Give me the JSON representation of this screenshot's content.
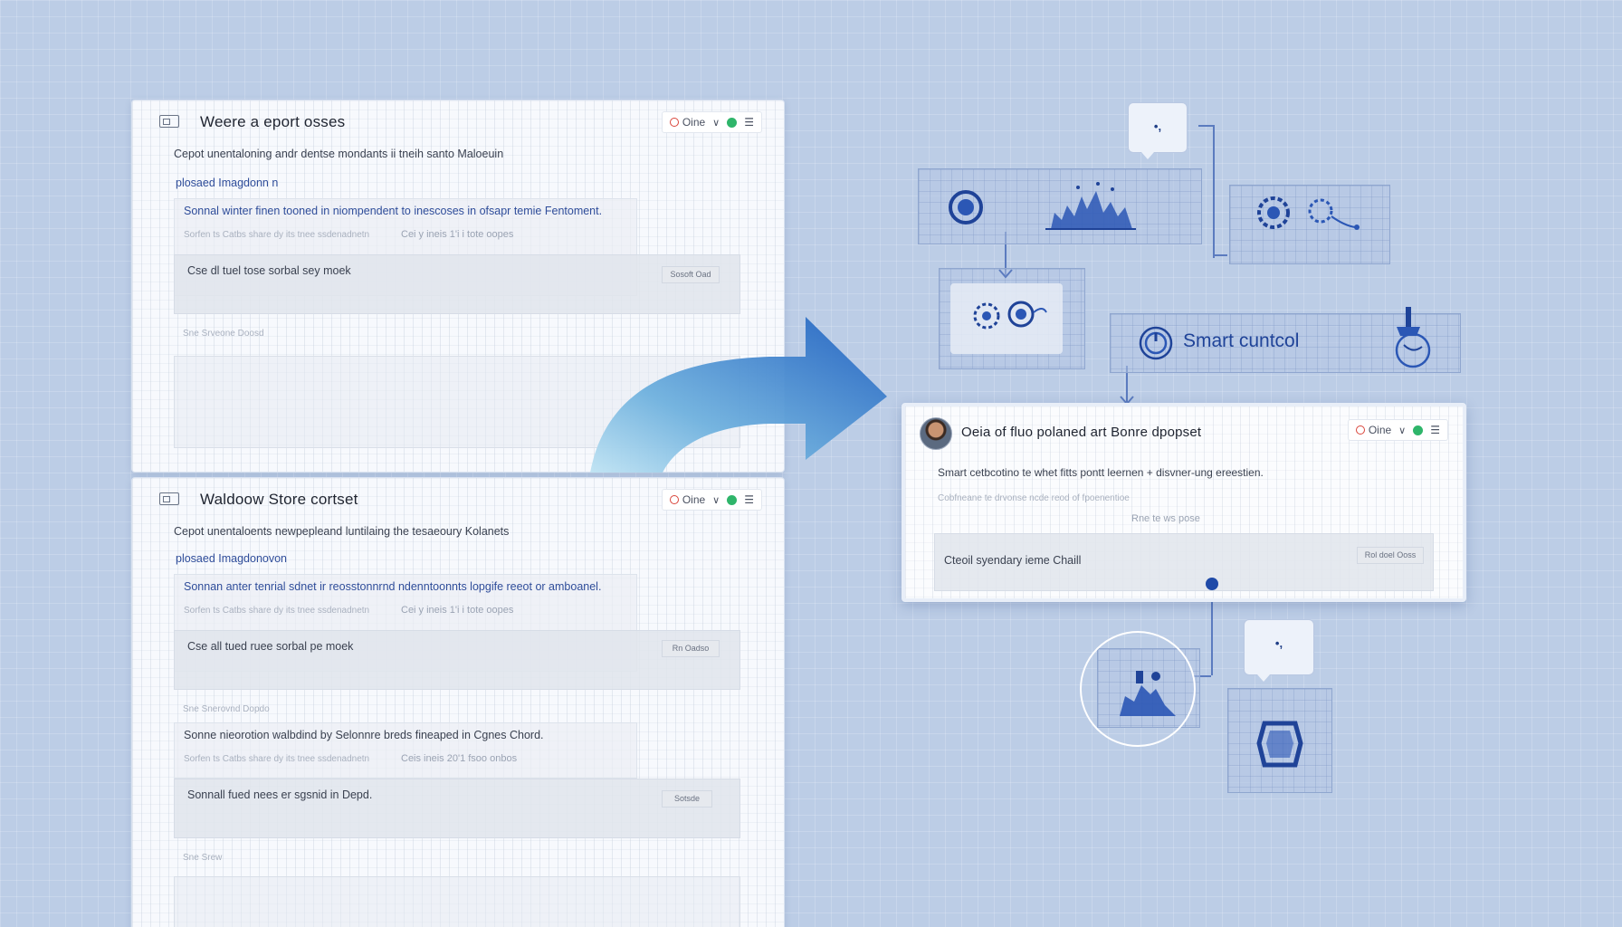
{
  "window1": {
    "title": "Weere a eport osses",
    "status_label": "Oine",
    "line1": "Cepot unentaloning andr dentse mondants ii tneih santo Maloeuin",
    "line2": "plosaed Imagdonn n",
    "card_line1": "Sonnal winter finen tooned in niompendent to inescoses in ofsapr temie Fentoment.",
    "card_line2_faint": "Sorfen ts Catbs share dy its tnee ssdenadnetn",
    "card_line2_tail": "Cei y ineis 1'i i tote oopes",
    "inner_line": "Cse dl tuel tose sorbal sey moek",
    "inner_tag": "Sosoft Oad",
    "section_label": "Sne Srveone Doosd"
  },
  "window2": {
    "title": "Waldoow Store cortset",
    "status_label": "Oine",
    "line1": "Cepot unentaloents newpepleand luntilaing the tesaeoury Kolanets",
    "line2": "plosaed Imagdonovon",
    "card_line1": "Sonnan anter tenrial sdnet ir reosstonnrnd ndenntoonnts lopgife reeot or amboanel.",
    "card_line2_faint": "Sorfen ts Catbs share dy its tnee ssdenadnetn",
    "card_line2_tail": "Cei y ineis 1'i i tote oopes",
    "inner_line": "Cse all tued ruee sorbal pe moek",
    "inner_tag": "Rn Oadso",
    "section_label": "Sne Snerovnd Dopdo",
    "card2_line1": "Sonne nieorotion walbdind by Selonnre breds fineaped in Cgnes Chord.",
    "card2_line2_faint": "Sorfen ts Catbs share dy its tnee ssdenadnetn",
    "card2_line2_tail": "Ceis ineis 20'1 fsoo onbos",
    "inner2_line": "Sonnall fued nees er sgsnid in Depd.",
    "inner2_tag": "Sotsde",
    "section2_label": "Sne Srew"
  },
  "smart_control": {
    "label": "Smart cuntcol"
  },
  "bubble_top": {
    "text": "•,"
  },
  "bubble_bottom": {
    "text": "•,"
  },
  "right_window": {
    "title": "Oeia of fluo polaned art Bonre dpopset",
    "status_label": "Oine",
    "line1": "Smart cetbcotino te whet fitts pontt leernen + disvner-ung ereestien.",
    "line2_faint": "Cobfneane te drvonse ncde reod of fpoenentioe",
    "line2_tail": "Rne te ws pose",
    "inner_line": "Cteoil syendary ieme Chaill",
    "inner_tag": "Rol doel Ooss"
  },
  "colors": {
    "background": "#bccde6",
    "accent_blue": "#1f4aa8",
    "status_green": "#2fb56a",
    "status_red": "#d9443a"
  }
}
